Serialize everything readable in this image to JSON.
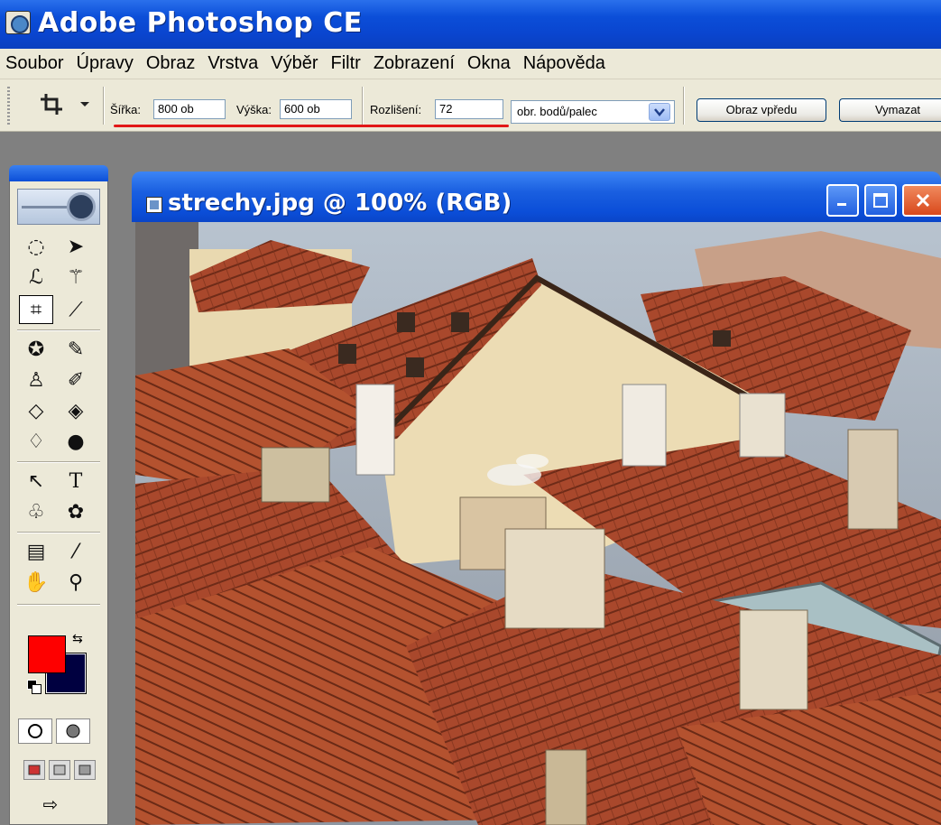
{
  "app": {
    "title": "Adobe Photoshop CE"
  },
  "menu": [
    "Soubor",
    "Úpravy",
    "Obraz",
    "Vrstva",
    "Výběr",
    "Filtr",
    "Zobrazení",
    "Okna",
    "Nápověda"
  ],
  "options": {
    "width_label": "Šířka:",
    "width_value": "800 ob",
    "height_label": "Výška:",
    "height_value": "600 ob",
    "resolution_label": "Rozlišení:",
    "resolution_value": "72",
    "resolution_unit": "obr. bodů/palec",
    "front_image_button": "Obraz vpředu",
    "clear_button": "Vymazat"
  },
  "document": {
    "title": "strechy.jpg @  100% (RGB)"
  },
  "tools": [
    "marquee-tool",
    "move-tool",
    "lasso-tool",
    "magic-wand-tool",
    "crop-tool",
    "slice-tool",
    "healing-brush-tool",
    "brush-tool",
    "clone-stamp-tool",
    "history-brush-tool",
    "eraser-tool",
    "paint-bucket-tool",
    "blur-tool",
    "dodge-tool",
    "path-selection-tool",
    "type-tool",
    "pen-tool",
    "custom-shape-tool",
    "notes-tool",
    "eyedropper-tool",
    "hand-tool",
    "zoom-tool"
  ],
  "colors": {
    "foreground": "#fe0000",
    "background": "#000040",
    "accent_underline": "#e21818"
  }
}
